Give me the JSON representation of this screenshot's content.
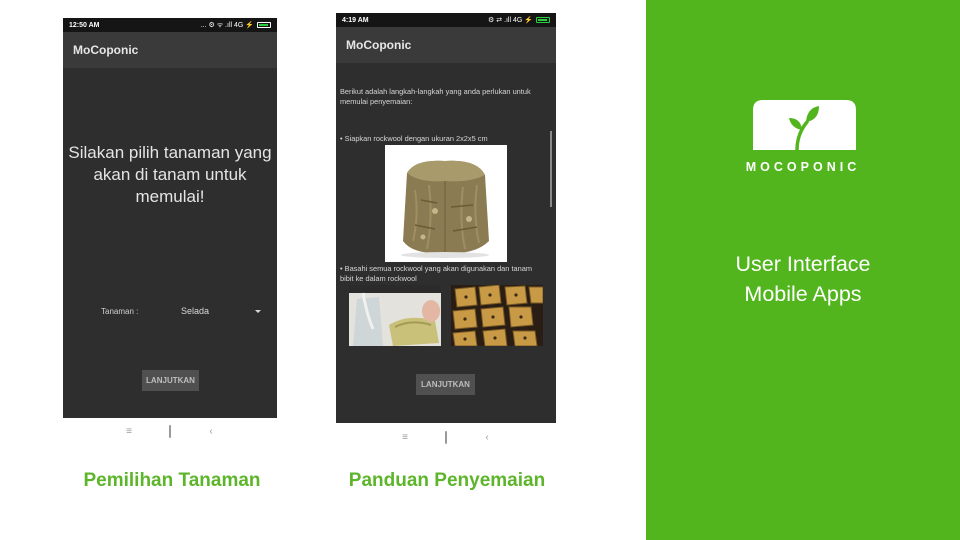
{
  "screen1": {
    "status_time": "12:50 AM",
    "status_icons": "... ⚙ ᯤ .ıll 4G ⚡",
    "app_title": "MoCoponic",
    "prompt": "Silakan pilih tanaman yang akan di tanam untuk memulai!",
    "field_label": "Tanaman :",
    "selected_plant": "Selada",
    "next_button": "LANJUTKAN",
    "caption": "Pemilihan Tanaman"
  },
  "screen2": {
    "status_time": "4:19 AM",
    "status_icons": "⚙ ⇄ .ıll 4G ⚡",
    "app_title": "MoCoponic",
    "intro_text": "Berikut adalah langkah-langkah yang anda perlukan untuk memulai penyemaian:",
    "step1": "• Siapkan rockwool dengan ukuran 2x2x5 cm",
    "step2": "• Basahi semua rockwool yang akan digunakan dan tanam bibit ke dalam rockwool",
    "next_button": "LANJUTKAN",
    "caption": "Panduan Penyemaian"
  },
  "nav_icons": {
    "menu": "≡",
    "back": "‹"
  },
  "panel": {
    "brand": "MOCOPONIC",
    "line1": "User Interface",
    "line2": "Mobile Apps"
  },
  "colors": {
    "brand_green": "#52b51e",
    "caption_green": "#5db52b",
    "app_background": "#2e2e2e"
  }
}
